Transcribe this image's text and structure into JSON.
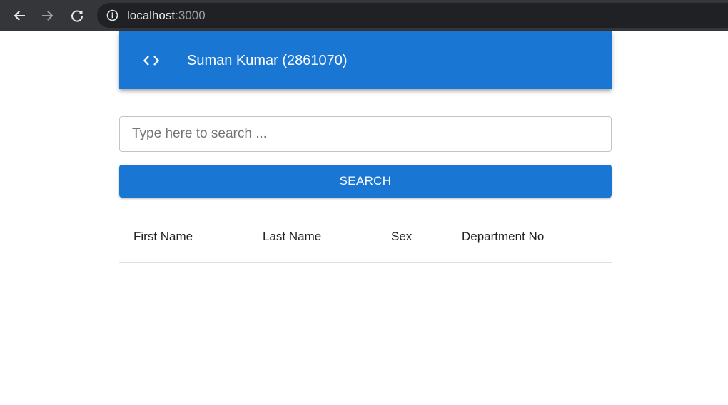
{
  "browser": {
    "url_host": "localhost",
    "url_port": ":3000",
    "icons": [
      "back-arrow-icon",
      "forward-arrow-icon",
      "reload-icon",
      "info-icon"
    ],
    "colors": {
      "toolbar": "#35363a",
      "omnibox": "#202124"
    }
  },
  "header": {
    "icon": "code-icon",
    "title": "Suman Kumar (2861070)",
    "color": "#1976d2"
  },
  "search": {
    "placeholder": "Type here to search ...",
    "value": "",
    "button_label": "SEARCH"
  },
  "table": {
    "columns": [
      "First Name",
      "Last Name",
      "Sex",
      "Department No"
    ],
    "rows": []
  }
}
